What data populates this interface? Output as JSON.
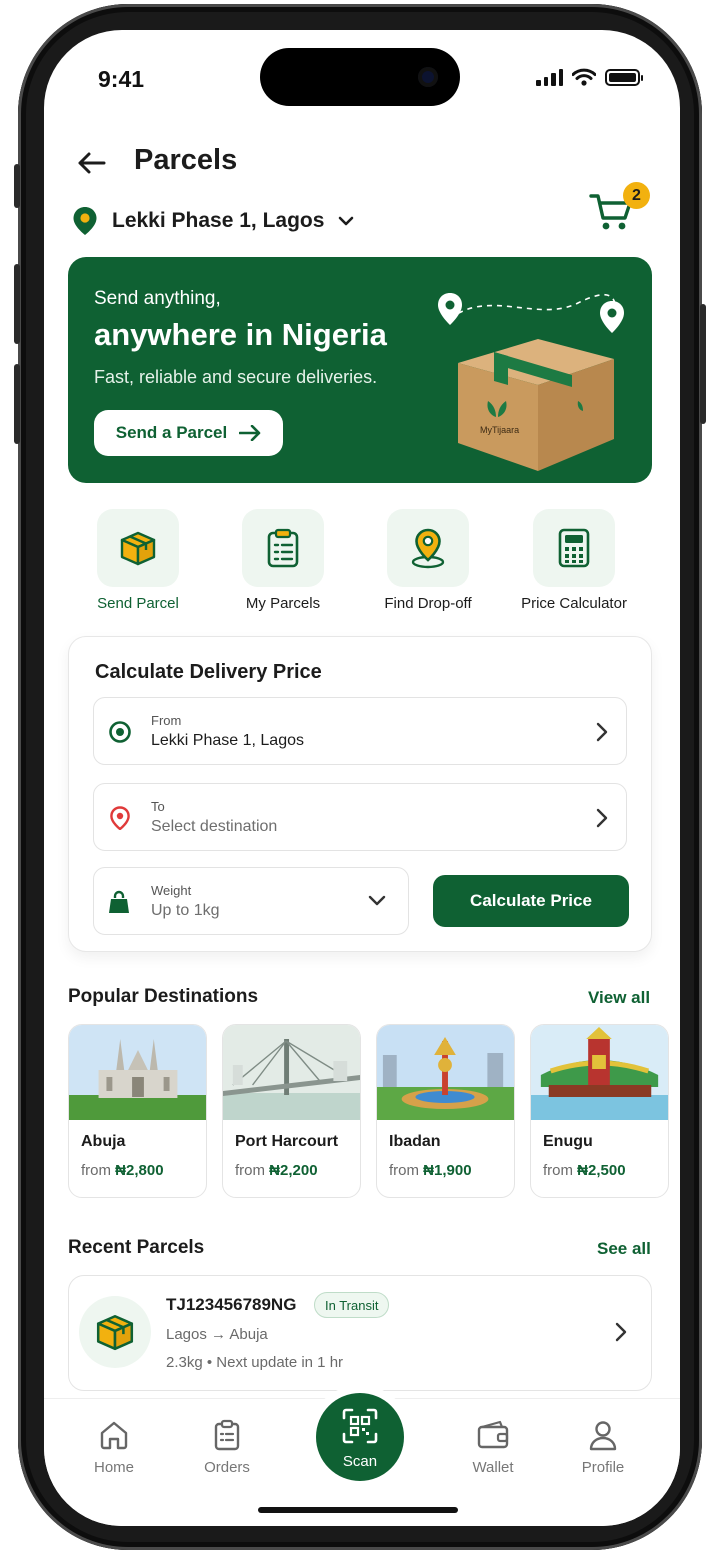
{
  "status_bar": {
    "time": "9:41"
  },
  "header": {
    "title": "Parcels",
    "location": "Lekki Phase 1, Lagos",
    "cart_count": "2"
  },
  "hero": {
    "line1": "Send anything,",
    "line2": "anywhere in Nigeria",
    "line3": "Fast, reliable and secure deliveries.",
    "button_label": "Send a Parcel",
    "box_brand": "MyTijaara"
  },
  "quick_actions": [
    {
      "label": "Send Parcel",
      "icon": "parcel-box-icon"
    },
    {
      "label": "My Parcels",
      "icon": "clipboard-icon"
    },
    {
      "label": "Find Drop-off",
      "icon": "map-pin-icon"
    },
    {
      "label": "Price Calculator",
      "icon": "calculator-icon"
    }
  ],
  "calculator": {
    "title": "Calculate Delivery Price",
    "from_label": "From",
    "from_value": "Lekki Phase 1, Lagos",
    "to_label": "To",
    "to_placeholder": "Select destination",
    "weight_label": "Weight",
    "weight_value": "Up to 1kg",
    "button_label": "Calculate Price"
  },
  "popular": {
    "title": "Popular Destinations",
    "link": "View all",
    "items": [
      {
        "name": "Abuja",
        "from": "from",
        "price": "₦2,800"
      },
      {
        "name": "Port Harcourt",
        "from": "from",
        "price": "₦2,200"
      },
      {
        "name": "Ibadan",
        "from": "from",
        "price": "₦1,900"
      },
      {
        "name": "Enugu",
        "from": "from",
        "price": "₦2,500"
      }
    ]
  },
  "recent": {
    "title": "Recent Parcels",
    "link": "See all",
    "items": [
      {
        "id": "TJ123456789NG",
        "status": "In Transit",
        "route": "Lagos → Abuja",
        "meta": "2.3kg  •  Next update in 1 hr"
      }
    ]
  },
  "nav": {
    "items": [
      {
        "label": "Home",
        "icon": "home-icon"
      },
      {
        "label": "Orders",
        "icon": "orders-icon"
      },
      {
        "label": "Scan",
        "icon": "qr-scan-icon"
      },
      {
        "label": "Wallet",
        "icon": "wallet-icon"
      },
      {
        "label": "Profile",
        "icon": "profile-icon"
      }
    ]
  },
  "colors": {
    "brand_green": "#0f6133",
    "accent_yellow": "#f2b10f",
    "tile_bg": "#eef6f0"
  }
}
